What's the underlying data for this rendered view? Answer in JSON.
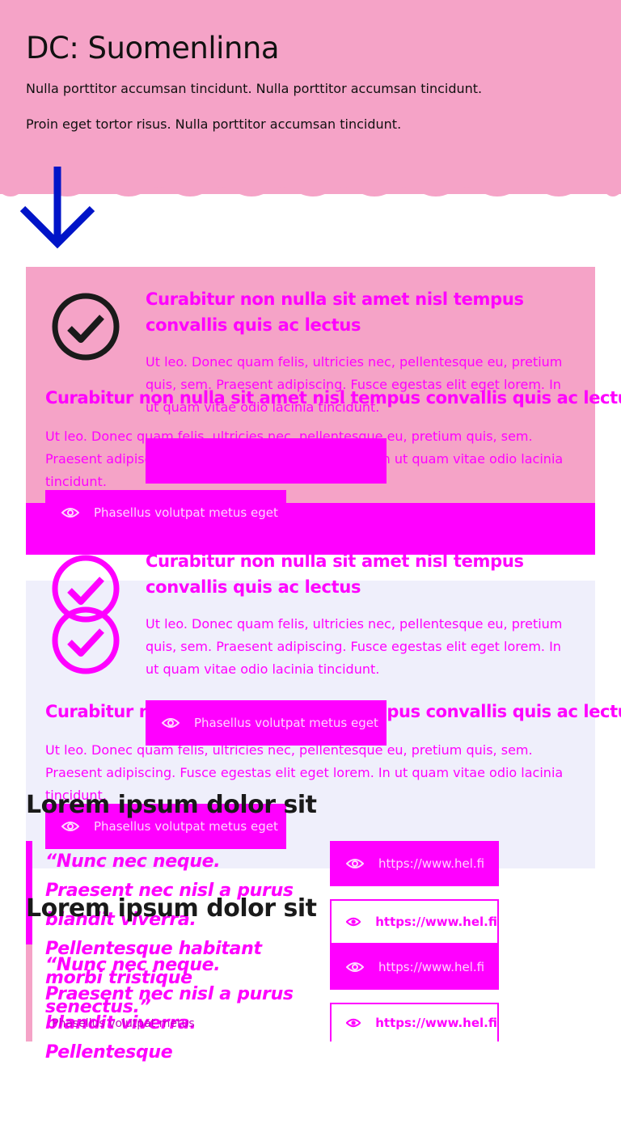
{
  "hero": {
    "title": "DC: Suomenlinna",
    "text1": "Nulla porttitor accumsan tincidunt. Nulla porttitor accumsan tincidunt.",
    "text2": "Proin eget tortor risus. Nulla porttitor accumsan tincidunt."
  },
  "colors": {
    "hero_bg": "#f5a3c7",
    "accent": "#ff00ff",
    "arrow": "#0014c8",
    "card_lavender": "#efeffb"
  },
  "cards": [
    {
      "heading": "Curabitur non nulla sit amet nisl tempus convallis quis ac lectus",
      "text": "Ut leo. Donec quam felis, ultricies nec, pellentesque eu, pretium quis, sem. Praesent adipiscing. Fusce egestas elit eget lorem. In ut quam vitae odio lacinia tincidunt.",
      "overlay_heading": "Curabitur non nulla sit amet nisl tempus convallis quis ac lectus",
      "overlay_text": "Ut leo. Donec quam felis, ultricies nec, pellentesque eu, pretium quis, sem. Praesent adipiscing. Fusce egestas elit eget lorem. In ut quam vitae odio lacinia tincidunt.",
      "button_label": "Phasellus volutpat metus eget",
      "button_icon": "eye-icon",
      "icon": "check-circle-icon"
    },
    {
      "heading": "Curabitur non nulla sit amet nisl tempus convallis quis ac lectus",
      "text": "Ut leo. Donec quam felis, ultricies nec, pellentesque eu, pretium quis, sem. Praesent adipiscing. Fusce egestas elit eget lorem. In ut quam vitae odio lacinia tincidunt.",
      "overlay_heading": "Curabitur non nulla sit amet nisl tempus convallis quis ac lectus",
      "overlay_text": "Ut leo. Donec quam felis, ultricies nec, pellentesque eu, pretium quis, sem. Praesent adipiscing. Fusce egestas elit eget lorem. In ut quam vitae odio lacinia tincidunt.",
      "button_label": "Phasellus volutpat metus eget",
      "overlay_button_label": "Phasellus volutpat metus eget",
      "button_icon": "eye-icon",
      "icon": "check-circle-icon"
    }
  ],
  "quotes": [
    {
      "heading": "Lorem ipsum dolor sit",
      "quote": "“Nunc nec neque. Praesent nec nisl a purus blandit viverra. Pellentesque habitant morbi tristique senectus.”",
      "link_label": "https://www.hel.fi"
    },
    {
      "heading": "Lorem ipsum dolor sit",
      "quote": "“Nunc nec neque. Praesent nec nisl a purus blandit viverra. Pellentesque",
      "caption": "Phasellus volutpat metus",
      "link_label": "https://www.hel.fi"
    }
  ],
  "links": {
    "hel_fi": "https://www.hel.fi"
  }
}
